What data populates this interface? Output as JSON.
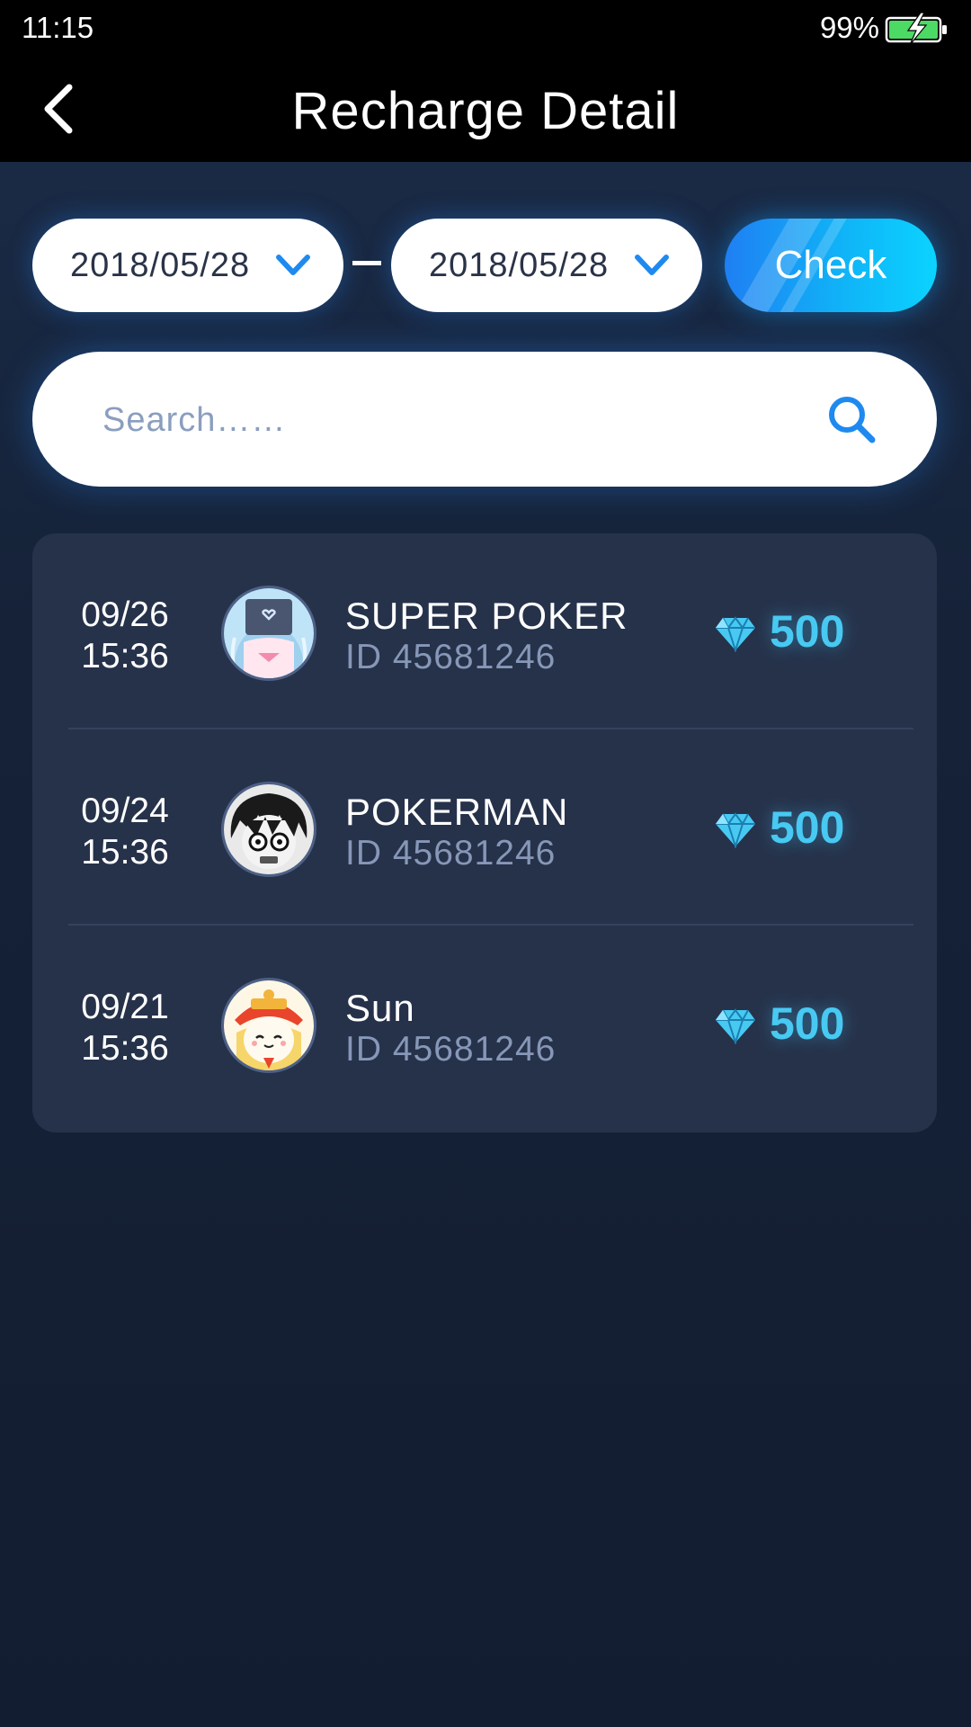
{
  "status_bar": {
    "time": "11:15",
    "battery": "99%"
  },
  "nav": {
    "title": "Recharge Detail"
  },
  "filter": {
    "date_from": "2018/05/28",
    "date_to": "2018/05/28",
    "check_label": "Check"
  },
  "search": {
    "placeholder": "Search……"
  },
  "records": [
    {
      "date": "09/26",
      "time": "15:36",
      "name": "SUPER POKER",
      "id": "ID 45681246",
      "amount": "500",
      "avatar": "anime-girl-avatar"
    },
    {
      "date": "09/24",
      "time": "15:36",
      "name": "POKERMAN",
      "id": "ID 45681246",
      "amount": "500",
      "avatar": "shocked-boy-avatar"
    },
    {
      "date": "09/21",
      "time": "15:36",
      "name": "Sun",
      "id": "ID 45681246",
      "amount": "500",
      "avatar": "monk-cat-avatar"
    }
  ],
  "colors": {
    "accent": "#47c9f2",
    "check_gradient_start": "#1f7ff3",
    "check_gradient_end": "#0bd3ff",
    "background": "#141e31",
    "card": "#26324a"
  }
}
